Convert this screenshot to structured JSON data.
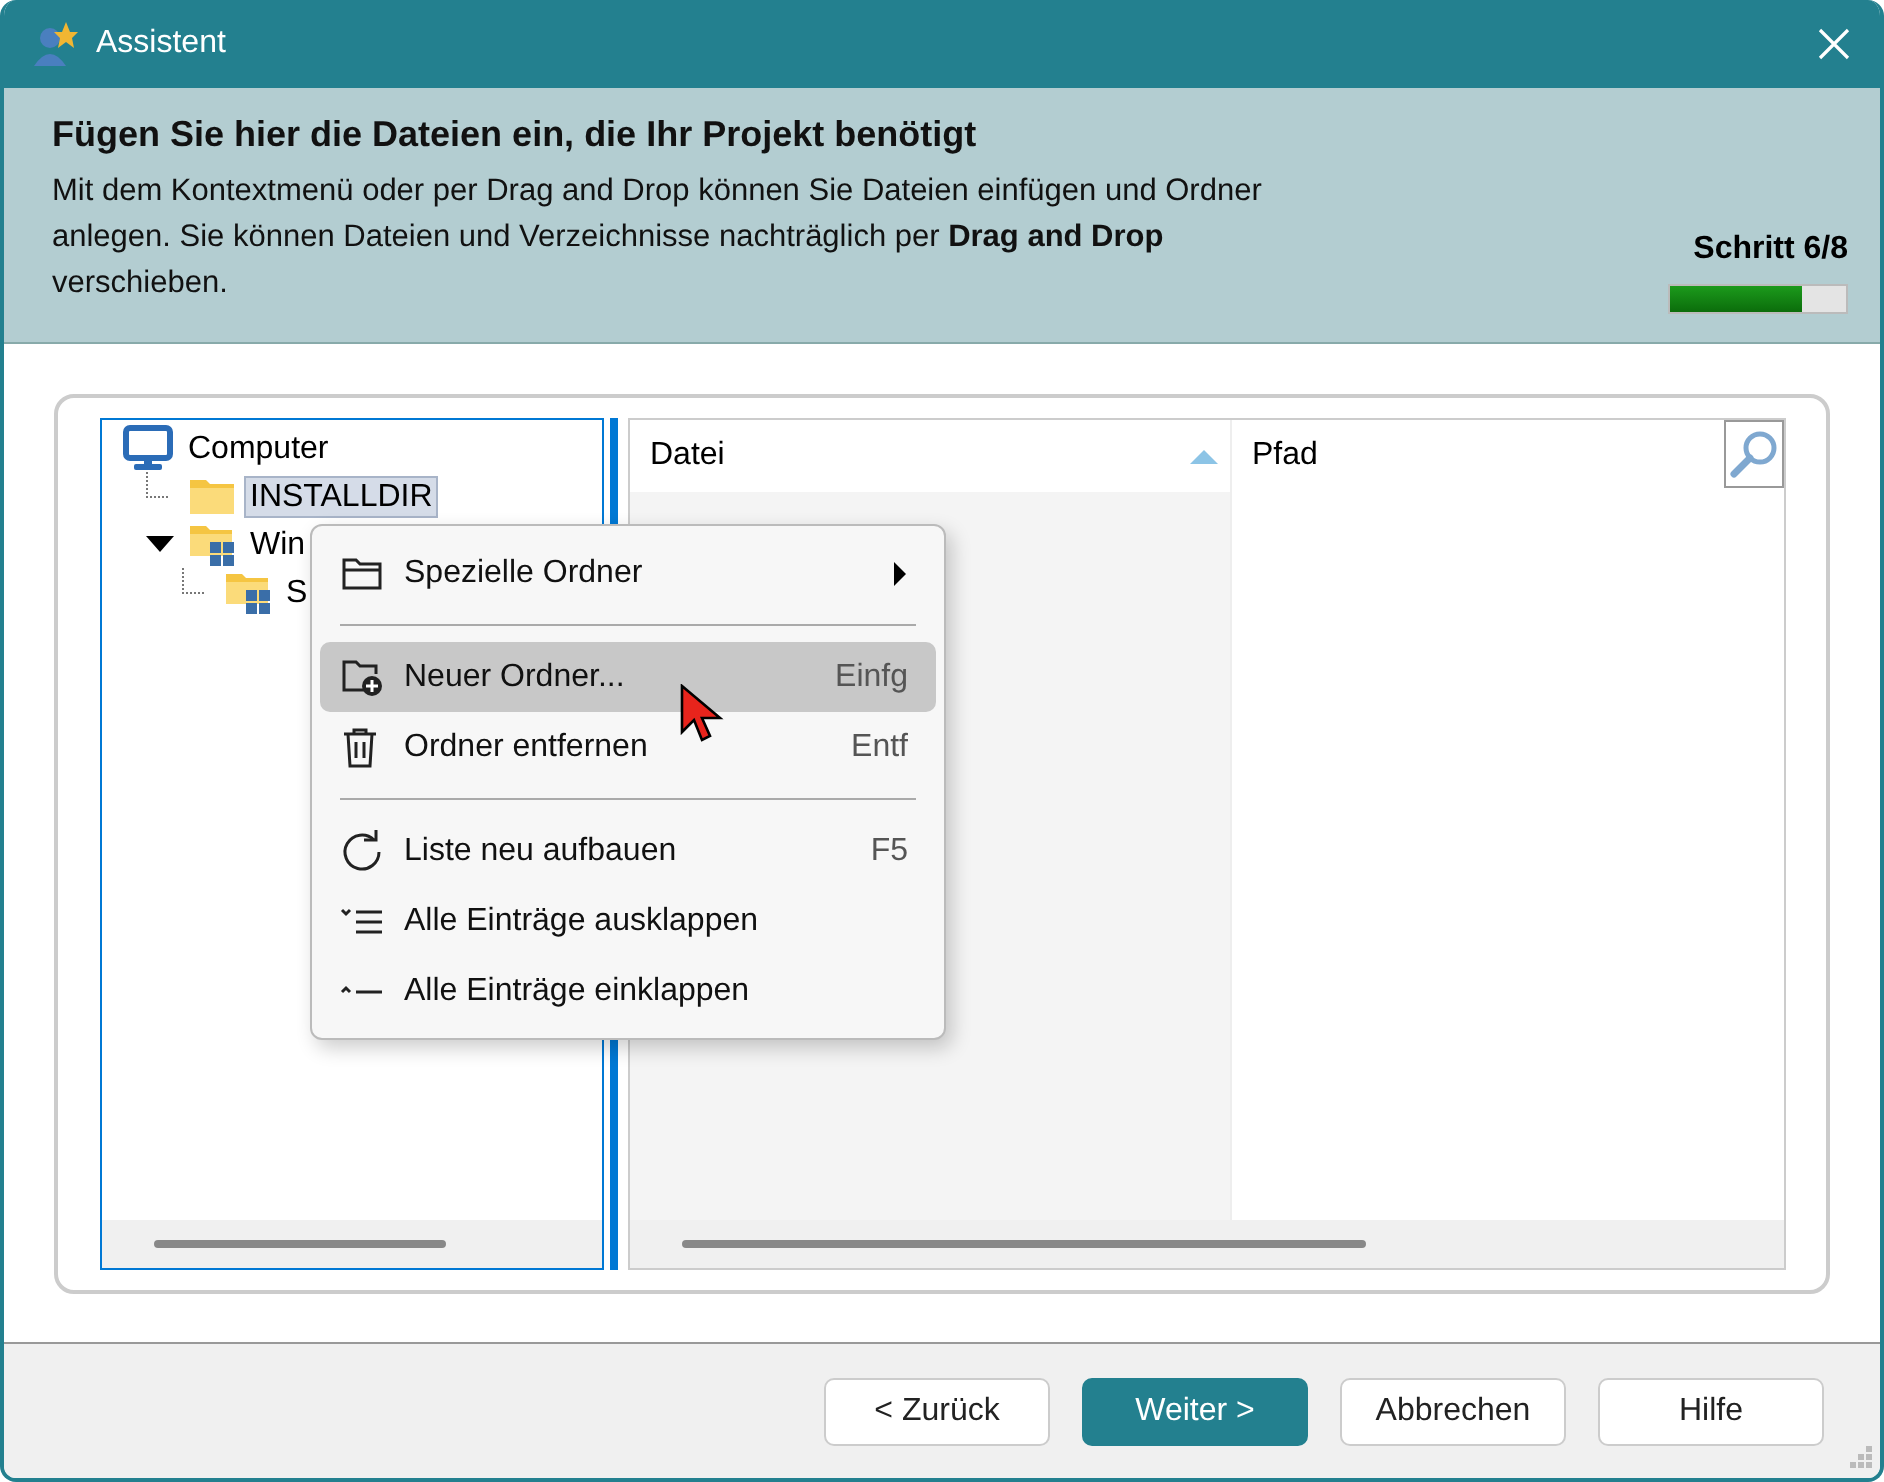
{
  "window": {
    "title": "Assistent"
  },
  "header": {
    "title": "Fügen Sie hier die Dateien ein, die Ihr Projekt benötigt",
    "description": "Mit dem Kontextmenü oder per Drag and Drop können Sie Dateien einfügen und Ordner anlegen. Sie können Dateien und Verzeichnisse nachträglich per **Drag and Drop** verschieben.",
    "step": "Schritt 6/8",
    "level": 0.75
  },
  "tree": [
    {
      "label": "Computer",
      "kind": "computer",
      "selected": false,
      "children": [
        {
          "label": "INSTALLDIR",
          "kind": "folder",
          "selected": true
        },
        {
          "label": "Win",
          "kind": "windows-folder",
          "selected": false,
          "expanded": true,
          "children": [
            {
              "label": "S",
              "kind": "windows-folder",
              "selected": false
            }
          ]
        }
      ]
    }
  ],
  "table": {
    "columns": [
      {
        "label": "Datei",
        "sorted": true
      },
      {
        "label": "Pfad",
        "sorted": false
      }
    ]
  },
  "context_menu": [
    {
      "kind": "item",
      "label": "Spezielle Ordner",
      "submenu": true,
      "selected": false
    },
    {
      "kind": "separator"
    },
    {
      "kind": "item",
      "label": "Neuer Ordner...",
      "shortcut": "Einfg",
      "submenu": false,
      "selected": true
    },
    {
      "kind": "item",
      "label": "Ordner entfernen",
      "shortcut": "Entf",
      "submenu": false,
      "selected": false
    },
    {
      "kind": "separator"
    },
    {
      "kind": "item",
      "label": "Liste neu aufbauen",
      "shortcut": "F5",
      "submenu": false,
      "selected": false
    },
    {
      "kind": "item",
      "label": "Alle Einträge ausklappen",
      "submenu": false,
      "selected": false
    },
    {
      "kind": "item",
      "label": "Alle Einträge einklappen",
      "submenu": false,
      "selected": false
    }
  ],
  "buttons": [
    {
      "label": "< Zurück",
      "primary": false
    },
    {
      "label": "Weiter >",
      "primary": true
    },
    {
      "label": "Abbrechen",
      "primary": false
    },
    {
      "label": "Hilfe",
      "primary": false
    }
  ]
}
